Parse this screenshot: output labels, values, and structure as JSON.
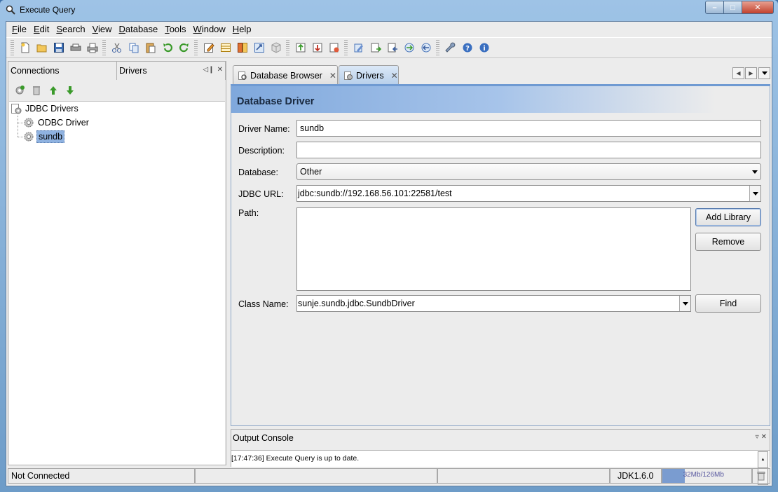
{
  "window": {
    "title": "Execute Query"
  },
  "menu": [
    {
      "label": "File",
      "key": "F",
      "rest": "ile"
    },
    {
      "label": "Edit",
      "key": "E",
      "rest": "dit"
    },
    {
      "label": "Search",
      "key": "S",
      "rest": "earch"
    },
    {
      "label": "View",
      "key": "V",
      "rest": "iew"
    },
    {
      "label": "Database",
      "key": "D",
      "rest": "atabase"
    },
    {
      "label": "Tools",
      "key": "T",
      "rest": "ools"
    },
    {
      "label": "Window",
      "key": "W",
      "rest": "indow"
    },
    {
      "label": "Help",
      "key": "H",
      "rest": "elp"
    }
  ],
  "left_panel": {
    "tabs": [
      "Connections",
      "Drivers"
    ],
    "tree": {
      "root": "JDBC Drivers",
      "children": [
        "ODBC Driver",
        "sundb"
      ],
      "selected": "sundb"
    }
  },
  "doc_tabs": [
    "Database Browser",
    "Drivers"
  ],
  "driver_form": {
    "header": "Database Driver",
    "labels": {
      "driver_name": "Driver Name:",
      "description": "Description:",
      "database": "Database:",
      "jdbc_url": "JDBC URL:",
      "path": "Path:",
      "class_name": "Class Name:"
    },
    "values": {
      "driver_name": "sundb",
      "description": "",
      "database": "Other",
      "jdbc_url": "jdbc:sundb://192.168.56.101:22581/test",
      "class_name": "sunje.sundb.jdbc.SundbDriver"
    },
    "buttons": {
      "add_library": "Add Library",
      "remove": "Remove",
      "find": "Find"
    }
  },
  "console": {
    "title": "Output Console",
    "message": "[17:47:36] Execute Query is up to date."
  },
  "status": {
    "connection": "Not Connected",
    "jdk": "JDK1.6.0",
    "memory": "32Mb/126Mb",
    "memory_fraction": 0.25
  }
}
